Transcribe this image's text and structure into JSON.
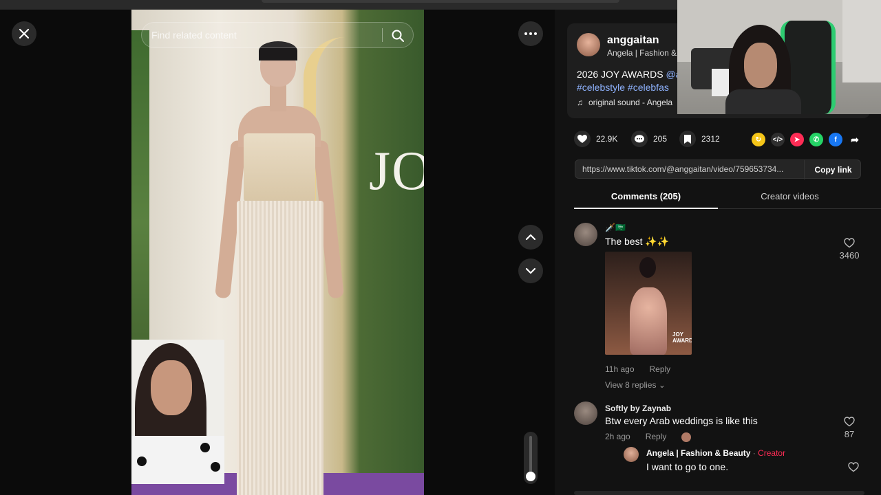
{
  "search": {
    "placeholder": "Find related content"
  },
  "author": {
    "username": "anggaitan",
    "nickname": "Angela | Fashion &",
    "desc_prefix": "2026 JOY AWARDS ",
    "desc_mention": "@a",
    "desc_tags": "#celebstyle #celebfas",
    "music": "original sound - Angela"
  },
  "actions": {
    "likes": "22.9K",
    "comments": "205",
    "saves": "2312"
  },
  "share_icons": [
    {
      "name": "repost-icon",
      "color": "#f5c518",
      "glyph": "↻"
    },
    {
      "name": "embed-icon",
      "color": "#2f2f2f",
      "glyph": "</>"
    },
    {
      "name": "send-icon",
      "color": "#fe2c55",
      "glyph": "➤"
    },
    {
      "name": "whatsapp-icon",
      "color": "#25d366",
      "glyph": "✆"
    },
    {
      "name": "facebook-icon",
      "color": "#1877f2",
      "glyph": "f"
    },
    {
      "name": "share-arrow-icon",
      "color": "transparent",
      "glyph": "➦"
    }
  ],
  "link": {
    "url": "https://www.tiktok.com/@anggaitan/video/759653734...",
    "copy_label": "Copy link"
  },
  "tabs": {
    "comments": "Comments (205)",
    "creator_videos": "Creator videos"
  },
  "comments": [
    {
      "user": "🗡️🇸🇦",
      "text": "The best ✨✨",
      "time": "11h ago",
      "reply_label": "Reply",
      "likes": "3460",
      "view_replies": "View 8 replies ⌄",
      "image_sign": "JOY AWARD"
    },
    {
      "user": "Softly by Zaynab",
      "text": "Btw every Arab weddings is like this",
      "time": "2h ago",
      "reply_label": "Reply",
      "likes": "87"
    }
  ],
  "reply": {
    "user": "Angela | Fashion & Beauty",
    "dot": " · ",
    "creator_label": "Creator",
    "text": "I want to go to one."
  },
  "video": {
    "letters": "JO"
  },
  "colors": {
    "accent": "#fe2c55",
    "link": "#8fb3ff",
    "panel": "#121212",
    "card": "#1e1e1e"
  }
}
